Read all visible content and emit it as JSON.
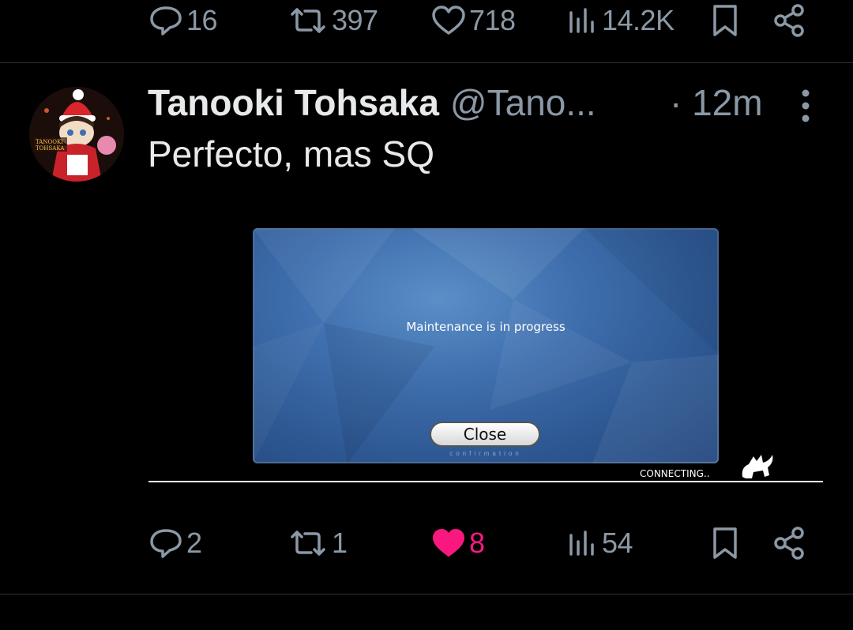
{
  "top_bar": {
    "replies": "16",
    "reposts": "397",
    "likes": "718",
    "views": "14.2K"
  },
  "tweet": {
    "display_name": "Tanooki Tohsaka",
    "handle": "@Tano...",
    "time": "· 12m",
    "text": "Perfecto, mas SQ",
    "avatar_text": "TANOOKI TOHSAKA",
    "media": {
      "message": "Maintenance is in progress",
      "close_label": "Close",
      "confirmation": "confirmation",
      "status": "CONNECTING.."
    },
    "actions": {
      "replies": "2",
      "reposts": "1",
      "likes": "8",
      "views": "54",
      "liked": true
    }
  },
  "colors": {
    "background": "#000000",
    "muted": "#8b98a5",
    "text": "#e7e9ea",
    "like_active": "#f91880",
    "divider": "#2f3336"
  },
  "icons": [
    "reply-icon",
    "repost-icon",
    "like-icon",
    "views-icon",
    "bookmark-icon",
    "share-icon",
    "more-icon"
  ]
}
